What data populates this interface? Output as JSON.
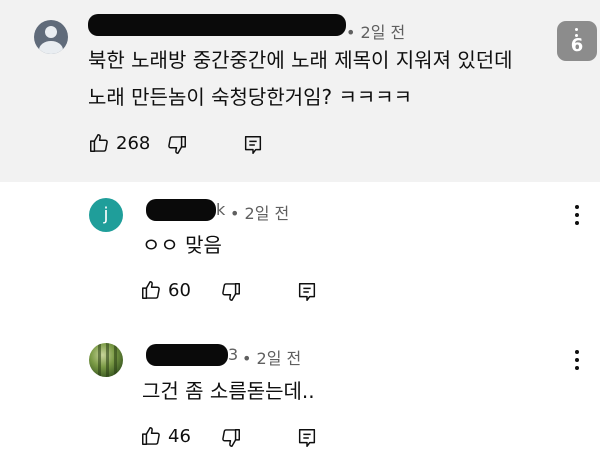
{
  "comment": {
    "meta": "• 2일 전",
    "line1": "북한 노래방 중간중간에 노래 제목이 지워져 있던데",
    "line2": "노래 만든놈이 숙청당한거임? ㅋㅋㅋㅋ",
    "likes": "268",
    "badge": "6"
  },
  "replies": [
    {
      "avatar_letter": "j",
      "name_suffix": "k",
      "meta": "• 2일 전",
      "text": "ㅇㅇ 맞음",
      "likes": "60"
    },
    {
      "avatar_icon": "bamboo-avatar",
      "name_suffix": "3",
      "meta": "• 2일 전",
      "text": "그건 좀 소름돋는데..",
      "likes": "46"
    }
  ],
  "icons": {
    "like": "thumbs-up-icon",
    "dislike": "thumbs-down-icon",
    "reply": "reply-icon",
    "more": "more-vert-icon"
  }
}
